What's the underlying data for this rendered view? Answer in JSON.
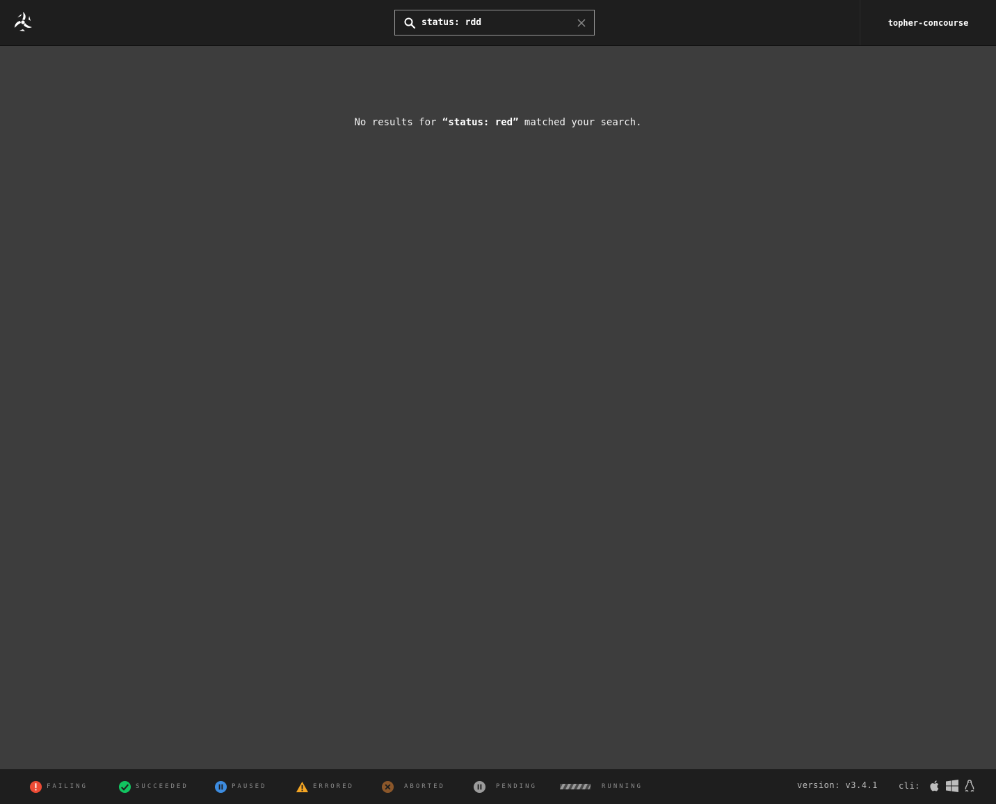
{
  "header": {
    "search": {
      "value": "status: rdd",
      "placeholder": "search"
    },
    "user": "topher-concourse"
  },
  "main": {
    "no_results_prefix": "No results for ",
    "query": "“status: red”",
    "no_results_suffix": " matched your search."
  },
  "legend": [
    {
      "label": "FAILING",
      "icon": "failing-icon",
      "color": "#ed4b35"
    },
    {
      "label": "SUCCEEDED",
      "icon": "succeeded-icon",
      "color": "#11c560"
    },
    {
      "label": "PAUSED",
      "icon": "paused-icon",
      "color": "#3d8ce0"
    },
    {
      "label": "ERRORED",
      "icon": "errored-icon",
      "color": "#f5a623"
    },
    {
      "label": "ABORTED",
      "icon": "aborted-icon",
      "color": "#8b572a"
    },
    {
      "label": "PENDING",
      "icon": "pending-icon",
      "color": "#9b9b9b"
    },
    {
      "label": "RUNNING",
      "icon": "running-icon",
      "color": "#9b9b9b"
    }
  ],
  "footer": {
    "version": "version: v3.4.1",
    "cli_label": "cli:",
    "cli_icons": [
      "apple-icon",
      "windows-icon",
      "linux-icon"
    ]
  }
}
